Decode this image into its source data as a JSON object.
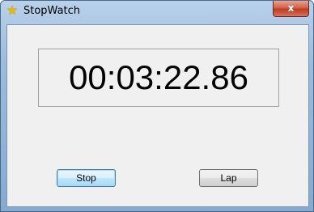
{
  "window": {
    "title": "StopWatch",
    "close_symbol": "x",
    "icon": "star-icon"
  },
  "display": {
    "time": "00:03:22.86"
  },
  "buttons": {
    "stop_label": "Stop",
    "lap_label": "Lap"
  },
  "colors": {
    "title_bar": "#9cbcdd",
    "client_background": "#f0f0f0",
    "close_button": "#c8452c",
    "icon": "#f2b705"
  }
}
